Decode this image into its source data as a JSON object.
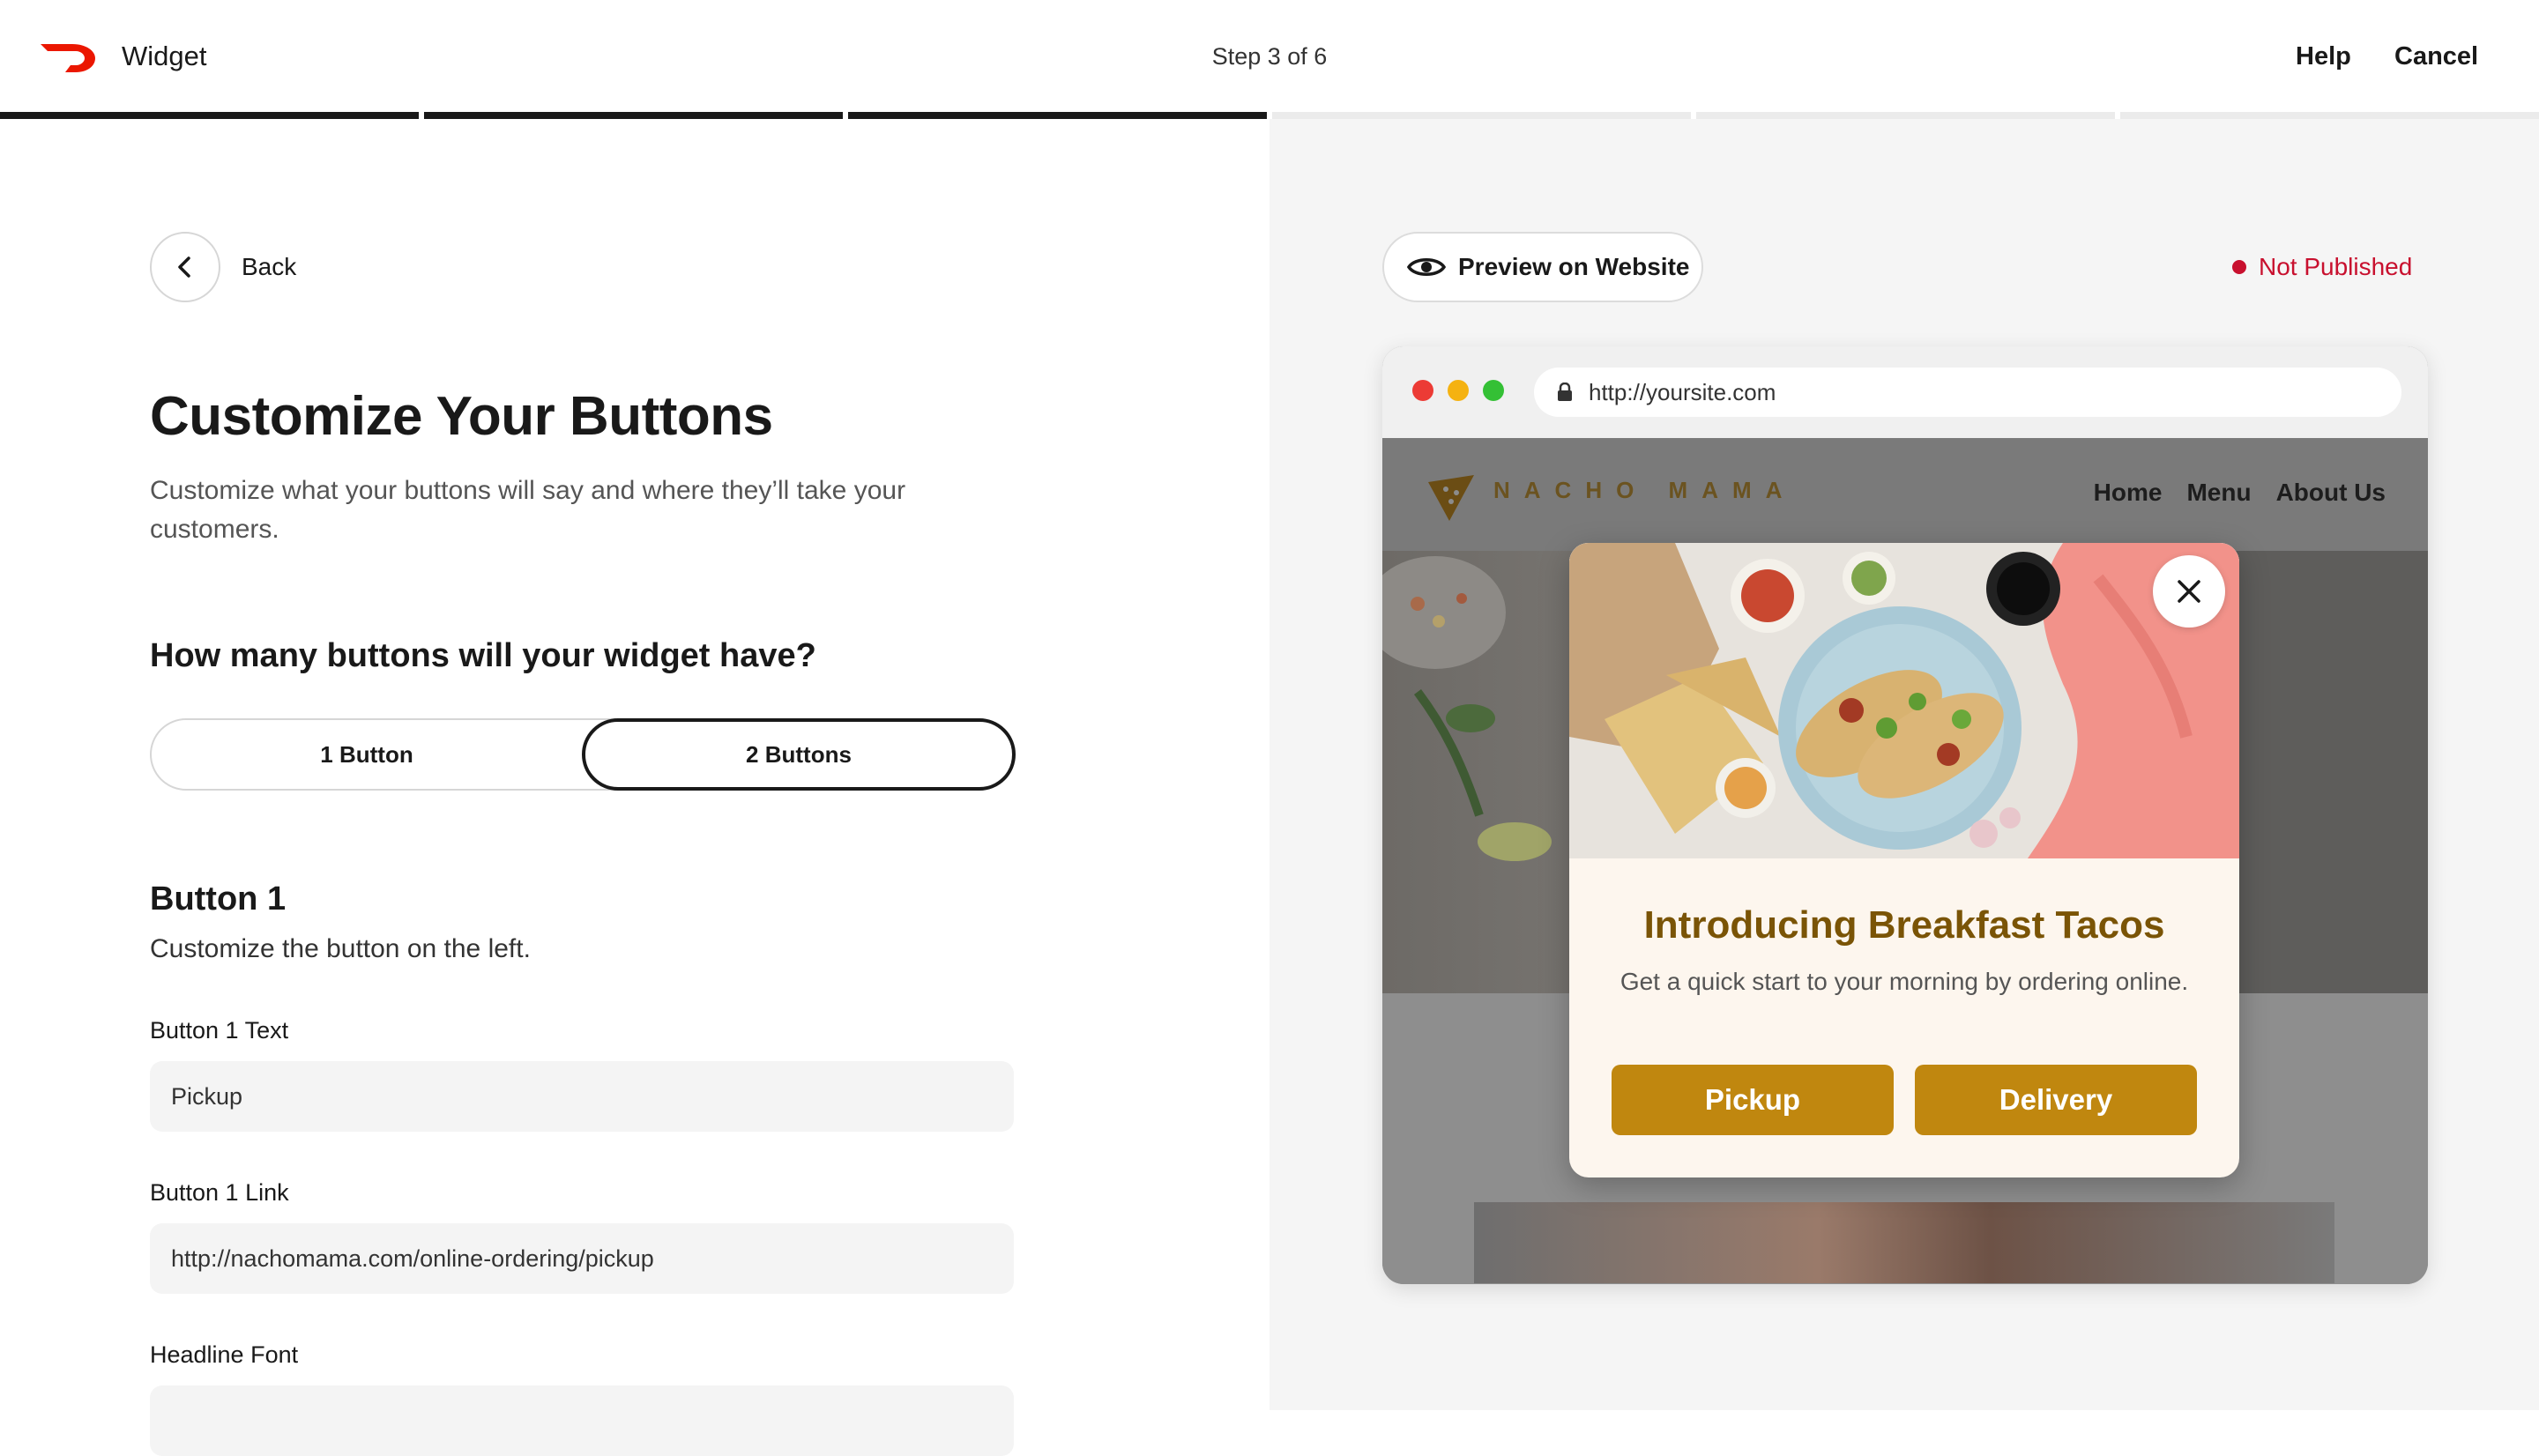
{
  "header": {
    "app_title": "Widget",
    "step": "Step 3 of 6",
    "help": "Help",
    "cancel": "Cancel",
    "progress": {
      "completed_steps": 3,
      "total_steps": 6
    }
  },
  "form": {
    "back": "Back",
    "title": "Customize Your Buttons",
    "subtitle": "Customize what your buttons will say and where they’ll take your customers.",
    "question": "How many buttons will your widget have?",
    "options": [
      "1 Button",
      "2 Buttons"
    ],
    "selected_option": "2 Buttons",
    "section_title": "Button 1",
    "section_subtitle": "Customize the button on the left.",
    "button1_text_label": "Button 1 Text",
    "button1_text_value": "Pickup",
    "button1_link_label": "Button 1 Link",
    "button1_link_value": "http://nachomama.com/online-ordering/pickup",
    "headline_font_label": "Headline Font"
  },
  "preview": {
    "preview_button": "Preview on Website",
    "status": "Not Published",
    "url": "http://yoursite.com",
    "site": {
      "logo_text": "NACHO MAMA",
      "nav": [
        "Home",
        "Menu",
        "About Us"
      ]
    },
    "modal": {
      "headline": "Introducing Breakfast Tacos",
      "body": "Get a quick start to your morning by ordering online.",
      "button1": "Pickup",
      "button2": "Delivery"
    }
  },
  "colors": {
    "brand_red": "#eb1700",
    "status_red": "#c8102e",
    "modal_button": "#c0870f",
    "modal_headline": "#7a5406",
    "progress_done": "#191919"
  },
  "icons": [
    "doordash-logo-icon",
    "chevron-left-icon",
    "eye-icon",
    "lock-icon",
    "close-icon",
    "nacho-logo-icon"
  ]
}
